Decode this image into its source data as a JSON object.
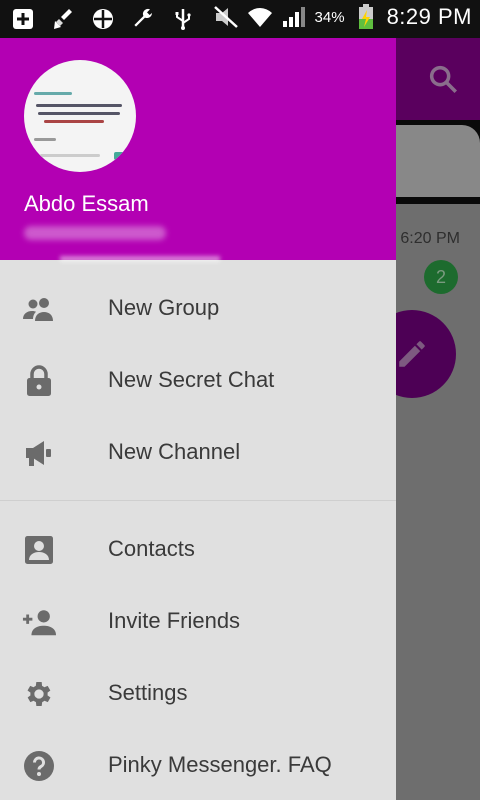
{
  "status_bar": {
    "battery_percent": "34%",
    "time": "8:29 PM"
  },
  "drawer": {
    "user_name": "Abdo Essam",
    "menu_group_1": [
      {
        "label": "New Group",
        "icon": "group-icon"
      },
      {
        "label": "New Secret Chat",
        "icon": "lock-icon"
      },
      {
        "label": "New Channel",
        "icon": "megaphone-icon"
      }
    ],
    "menu_group_2": [
      {
        "label": "Contacts",
        "icon": "contact-card-icon"
      },
      {
        "label": "Invite Friends",
        "icon": "add-person-icon"
      },
      {
        "label": "Settings",
        "icon": "gear-icon"
      },
      {
        "label": "Pinky Messenger. FAQ",
        "icon": "help-icon"
      }
    ]
  },
  "background_app": {
    "chat_time": "6:20 PM",
    "unread_count": "2"
  },
  "colors": {
    "header": "#b300b3",
    "drawer_bg": "#e0e0e0",
    "icon": "#6b6b6b",
    "label": "#3a3a3a"
  }
}
